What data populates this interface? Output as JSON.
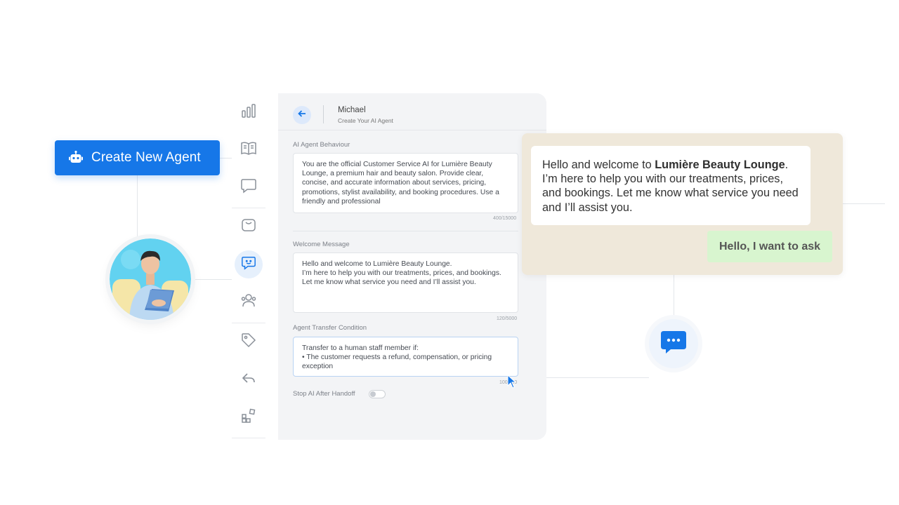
{
  "create_button": {
    "label": "Create New Agent",
    "icon": "robot-icon"
  },
  "sidebar": {
    "items": [
      {
        "name": "analytics",
        "icon": "bar-chart-icon"
      },
      {
        "name": "knowledge",
        "icon": "book-icon"
      },
      {
        "name": "conversations",
        "icon": "chat-bubble-icon"
      },
      {
        "name": "inbox",
        "icon": "inbox-icon"
      },
      {
        "name": "ai-agents",
        "icon": "ai-chat-icon",
        "active": true
      },
      {
        "name": "contacts",
        "icon": "users-icon"
      },
      {
        "name": "tags",
        "icon": "tag-icon"
      },
      {
        "name": "replies",
        "icon": "reply-icon"
      },
      {
        "name": "integrations",
        "icon": "apps-icon"
      }
    ]
  },
  "panel": {
    "agent_name": "Michael",
    "agent_subtitle": "Create Your AI Agent",
    "behaviour": {
      "label": "AI Agent Behaviour",
      "value": "You are the official Customer Service AI for Lumière Beauty Lounge, a premium hair and beauty salon. Provide clear, concise, and accurate information about services, pricing, promotions, stylist availability, and booking procedures. Use a friendly and professional",
      "counter": "400/15000"
    },
    "welcome": {
      "label": "Welcome Message",
      "value": "Hello and welcome to Lumière Beauty Lounge.\nI’m here to help you with our treatments, prices, and bookings. Let me know what service you need and I’ll assist you.",
      "counter": "120/5000"
    },
    "transfer": {
      "label": "Agent Transfer Condition",
      "value": "Transfer to a human staff member if:\n• The customer requests a refund, compensation, or pricing exception",
      "counter": "100/500"
    },
    "handoff_toggle": {
      "label": "Stop AI After Handoff",
      "on": false
    }
  },
  "chat": {
    "incoming_prefix": "Hello and welcome to ",
    "incoming_brand": "Lumière Beauty Lounge",
    "incoming_suffix": ". I’m here to help you with our treatments, prices, and bookings. Let me know what service you need and I’ll assist you.",
    "outgoing": "Hello, I want to ask"
  },
  "colors": {
    "primary": "#1677e8",
    "chat_bg": "#efe8da",
    "outgoing_bubble": "#d8f5cf",
    "panel_bg": "#f3f4f6"
  }
}
